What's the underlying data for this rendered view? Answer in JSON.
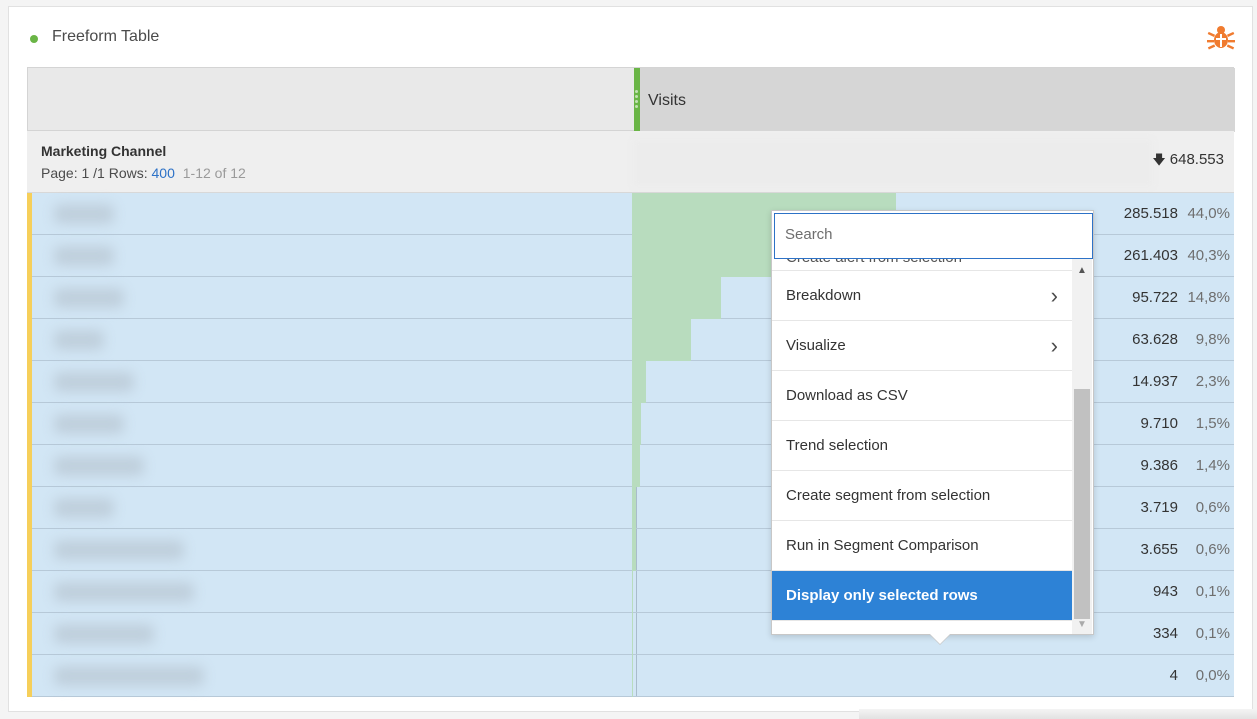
{
  "panel": {
    "title": "Freeform Table",
    "status_color": "#6ab546",
    "icon": "bug-icon"
  },
  "table": {
    "metric_label": "Visits",
    "dimension_name": "Marketing Channel",
    "page_label": "Page: 1 /1 Rows:",
    "rows_value": "400",
    "range_label": "1-12 of 12",
    "total": "648.553",
    "sort_icon": "sort-down-arrow-icon",
    "rows": [
      {
        "value": "285.518",
        "pct": "44,0%",
        "share": 0.44
      },
      {
        "value": "261.403",
        "pct": "40,3%",
        "share": 0.403
      },
      {
        "value": "95.722",
        "pct": "14,8%",
        "share": 0.148
      },
      {
        "value": "63.628",
        "pct": "9,8%",
        "share": 0.098
      },
      {
        "value": "14.937",
        "pct": "2,3%",
        "share": 0.023
      },
      {
        "value": "9.710",
        "pct": "1,5%",
        "share": 0.015
      },
      {
        "value": "9.386",
        "pct": "1,4%",
        "share": 0.014
      },
      {
        "value": "3.719",
        "pct": "0,6%",
        "share": 0.006
      },
      {
        "value": "3.655",
        "pct": "0,6%",
        "share": 0.006
      },
      {
        "value": "943",
        "pct": "0,1%",
        "share": 0.001
      },
      {
        "value": "334",
        "pct": "0,1%",
        "share": 0.001
      },
      {
        "value": "4",
        "pct": "0,0%",
        "share": 0.0
      }
    ]
  },
  "context_menu": {
    "search_placeholder": "Search",
    "items": [
      {
        "label": "Create alert from selection",
        "has_submenu": false
      },
      {
        "label": "Breakdown",
        "has_submenu": true
      },
      {
        "label": "Visualize",
        "has_submenu": true
      },
      {
        "label": "Download as CSV",
        "has_submenu": false
      },
      {
        "label": "Trend selection",
        "has_submenu": false
      },
      {
        "label": "Create segment from selection",
        "has_submenu": false
      },
      {
        "label": "Run in Segment Comparison",
        "has_submenu": false
      },
      {
        "label": "Display only selected rows",
        "has_submenu": false,
        "selected": true
      }
    ],
    "selected_color": "#2d82d6"
  }
}
